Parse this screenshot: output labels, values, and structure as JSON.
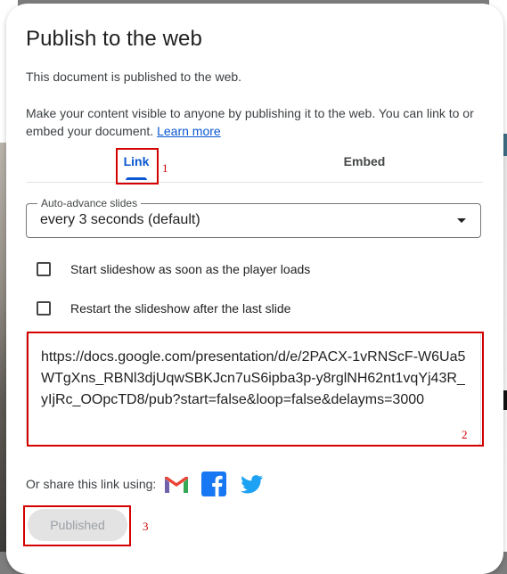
{
  "dialog": {
    "title": "Publish to the web",
    "status_text": "This document is published to the web.",
    "description": "Make your content visible to anyone by publishing it to the web. You can link to or embed your document.",
    "learn_more": "Learn more"
  },
  "tabs": [
    {
      "label": "Link",
      "active": true
    },
    {
      "label": "Embed",
      "active": false
    }
  ],
  "auto_advance": {
    "label": "Auto-advance slides",
    "value": "every 3 seconds (default)"
  },
  "options": [
    {
      "label": "Start slideshow as soon as the player loads",
      "checked": false
    },
    {
      "label": "Restart the slideshow after the last slide",
      "checked": false
    }
  ],
  "publish_url": "https://docs.google.com/presentation/d/e/2PACX-1vRNScF-W6Ua5WTgXns_RBNl3djUqwSBKJcn7uS6ipba3p-y8rglNH62nt1vqYj43R_yIjRc_OOpcTD8/pub?start=false&loop=false&delayms=3000",
  "share": {
    "label": "Or share this link using:",
    "icons": [
      "gmail-icon",
      "facebook-icon",
      "twitter-icon"
    ]
  },
  "published_button": "Published",
  "annotations": [
    "1",
    "2",
    "3"
  ],
  "colors": {
    "accent": "#0b57d0",
    "annotation": "#d40000",
    "facebook": "#1877f2",
    "twitter": "#1da1f2"
  }
}
